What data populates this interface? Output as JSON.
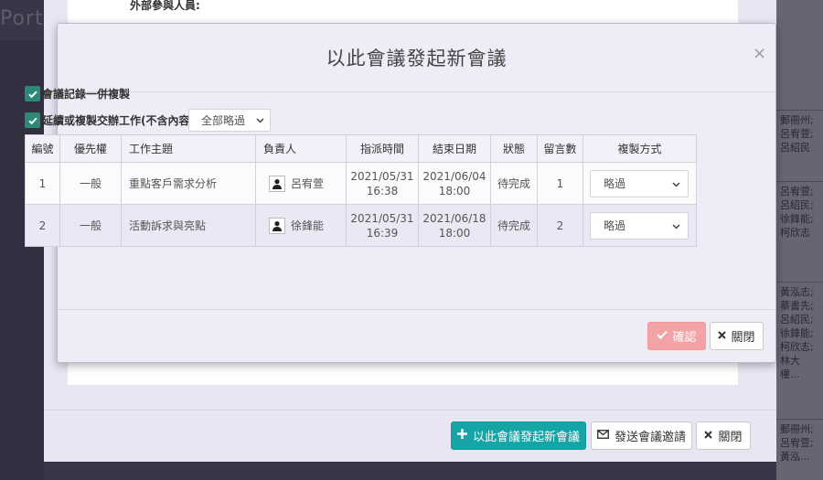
{
  "background": {
    "portal_label": "Porta",
    "right_cells": [
      {
        "text": "郵冊州;呂宥萱;呂紹民"
      },
      {
        "text": "呂宥萱;呂紹民;徐鋒能;柯欣志"
      },
      {
        "text": "黃泓志;蔡書先;呂紹民;徐鋒能;柯欣志;林大權..."
      },
      {
        "text": "郵冊州;呂宥萱;黃泓..."
      }
    ]
  },
  "outer_modal": {
    "field_label": "外部參與人員:",
    "btn_new_meeting": "以此會議發起新會議",
    "btn_send_invite": "發送會議邀請",
    "btn_close": "關閉"
  },
  "modal": {
    "title": "以此會議發起新會議",
    "close_symbol": "×",
    "copy_records_label": "會議記錄一併複製",
    "copy_records_checked": true,
    "extend_tasks_label": "延續或複製交辦工作(不含內容)",
    "extend_tasks_checked": true,
    "bulk_select_value": "全部略過",
    "table": {
      "headers": [
        "編號",
        "優先權",
        "工作主題",
        "負責人",
        "指派時間",
        "結束日期",
        "狀態",
        "留言數",
        "複製方式"
      ],
      "rows": [
        {
          "no": "1",
          "priority": "一般",
          "topic": "重點客戶需求分析",
          "owner": "呂宥萱",
          "assigned_date": "2021/05/31",
          "assigned_time": "16:38",
          "end_date": "2021/06/04",
          "end_time": "18:00",
          "status": "待完成",
          "comments": "1",
          "copy_mode": "略過"
        },
        {
          "no": "2",
          "priority": "一般",
          "topic": "活動訴求與亮點",
          "owner": "徐鋒能",
          "assigned_date": "2021/05/31",
          "assigned_time": "16:39",
          "end_date": "2021/06/18",
          "end_time": "18:00",
          "status": "待完成",
          "comments": "2",
          "copy_mode": "略過"
        }
      ]
    },
    "btn_confirm": "確認",
    "btn_close": "關閉"
  },
  "colors": {
    "primary_teal": "#16a5a7",
    "checkbox_green": "#2a8a75",
    "confirm_pink": "#f3a2a6"
  }
}
